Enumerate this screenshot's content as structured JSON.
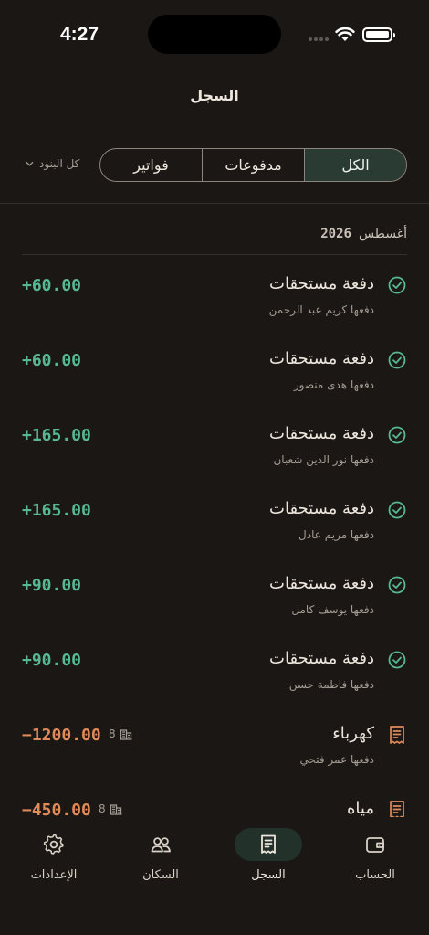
{
  "status_bar": {
    "time": "4:27"
  },
  "page_title": "السجل",
  "segments": [
    {
      "label": "الكل",
      "active": true
    },
    {
      "label": "مدفوعات",
      "active": false
    },
    {
      "label": "فواتير",
      "active": false
    }
  ],
  "filter_label": "كل البنود",
  "section": {
    "month": "أغسطس",
    "year": "2026"
  },
  "transactions": [
    {
      "kind": "payment",
      "title": "دفعة مستحقات",
      "subtitle": "دفعها كريم عبد الرحمن",
      "amount": "+60.00"
    },
    {
      "kind": "payment",
      "title": "دفعة مستحقات",
      "subtitle": "دفعها هدى منصور",
      "amount": "+60.00"
    },
    {
      "kind": "payment",
      "title": "دفعة مستحقات",
      "subtitle": "دفعها نور الدين شعبان",
      "amount": "+165.00"
    },
    {
      "kind": "payment",
      "title": "دفعة مستحقات",
      "subtitle": "دفعها مريم عادل",
      "amount": "+165.00"
    },
    {
      "kind": "payment",
      "title": "دفعة مستحقات",
      "subtitle": "دفعها يوسف كامل",
      "amount": "+90.00"
    },
    {
      "kind": "payment",
      "title": "دفعة مستحقات",
      "subtitle": "دفعها فاطمة حسن",
      "amount": "+90.00"
    },
    {
      "kind": "bill",
      "title": "كهرباء",
      "subtitle": "دفعها عمر فتحي",
      "amount": "−1200.00",
      "units": "8"
    },
    {
      "kind": "bill",
      "title": "مياه",
      "subtitle": "",
      "amount": "−450.00",
      "units": "8"
    }
  ],
  "tabs": [
    {
      "label": "الحساب",
      "icon": "wallet-icon",
      "active": false
    },
    {
      "label": "السجل",
      "icon": "receipt-icon",
      "active": true
    },
    {
      "label": "السكان",
      "icon": "people-icon",
      "active": false
    },
    {
      "label": "الإعدادات",
      "icon": "gear-icon",
      "active": false
    }
  ],
  "colors": {
    "background": "#1a1714",
    "accent_green": "#58b895",
    "accent_orange": "#e08a5a",
    "active_segment": "#2a3b33"
  }
}
